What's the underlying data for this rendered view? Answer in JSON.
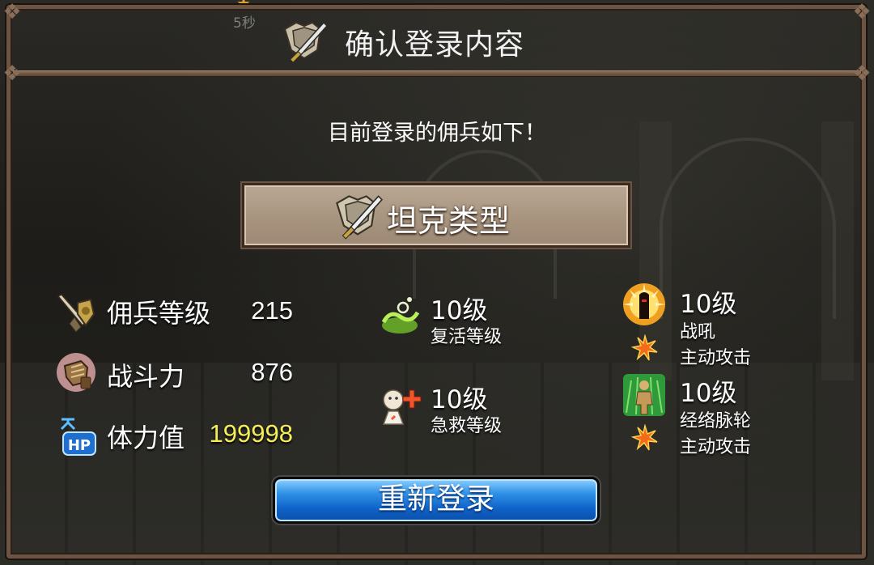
{
  "timer": {
    "text": "5秒"
  },
  "dialog": {
    "title": "确认登录内容",
    "subtitle": "目前登录的佣兵如下！",
    "type_label": "坦克类型"
  },
  "stats": {
    "level": {
      "label": "佣兵等级",
      "value": "215",
      "icon": "sword-shield-icon"
    },
    "power": {
      "label": "战斗力",
      "value": "876",
      "icon": "gauntlet-icon"
    },
    "hp": {
      "label": "体力值",
      "value": "199998",
      "icon": "hp-up-icon"
    }
  },
  "skills": {
    "revive": {
      "level": "10级",
      "name": "复活等级",
      "icon": "revive-icon"
    },
    "first_aid": {
      "level": "10级",
      "name": "急救等级",
      "icon": "first-aid-icon"
    },
    "warcry": {
      "level": "10级",
      "name": "战吼",
      "type": "主动攻击",
      "icon": "warcry-icon"
    },
    "meridian": {
      "level": "10级",
      "name": "经络脉轮",
      "type": "主动攻击",
      "icon": "meridian-icon"
    }
  },
  "buttons": {
    "relogin": "重新登录"
  },
  "colors": {
    "hp_value": "#f3ee5a",
    "button_blue": "#1f75d8",
    "plate": "#a99681",
    "frame": "#6b5443"
  }
}
